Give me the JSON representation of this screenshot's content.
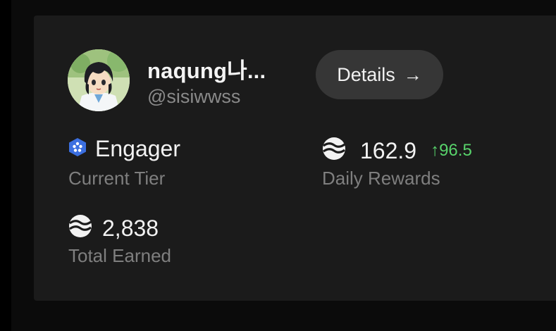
{
  "profile": {
    "display_name": "naqung나...",
    "handle": "@sisiwwss"
  },
  "actions": {
    "details_label": "Details",
    "details_icon": "arrow-right-icon",
    "details_arrow": "→"
  },
  "stats": {
    "tier": {
      "value": "Engager",
      "label": "Current Tier",
      "icon": "tier-hexagon-icon",
      "icon_color": "#3b6fe0"
    },
    "daily_rewards": {
      "value": "162.9",
      "change": "↑96.5",
      "label": "Daily Rewards",
      "icon": "token-wave-icon",
      "change_color": "#58d36b"
    },
    "total_earned": {
      "value": "2,838",
      "label": "Total Earned",
      "icon": "token-wave-icon"
    }
  }
}
